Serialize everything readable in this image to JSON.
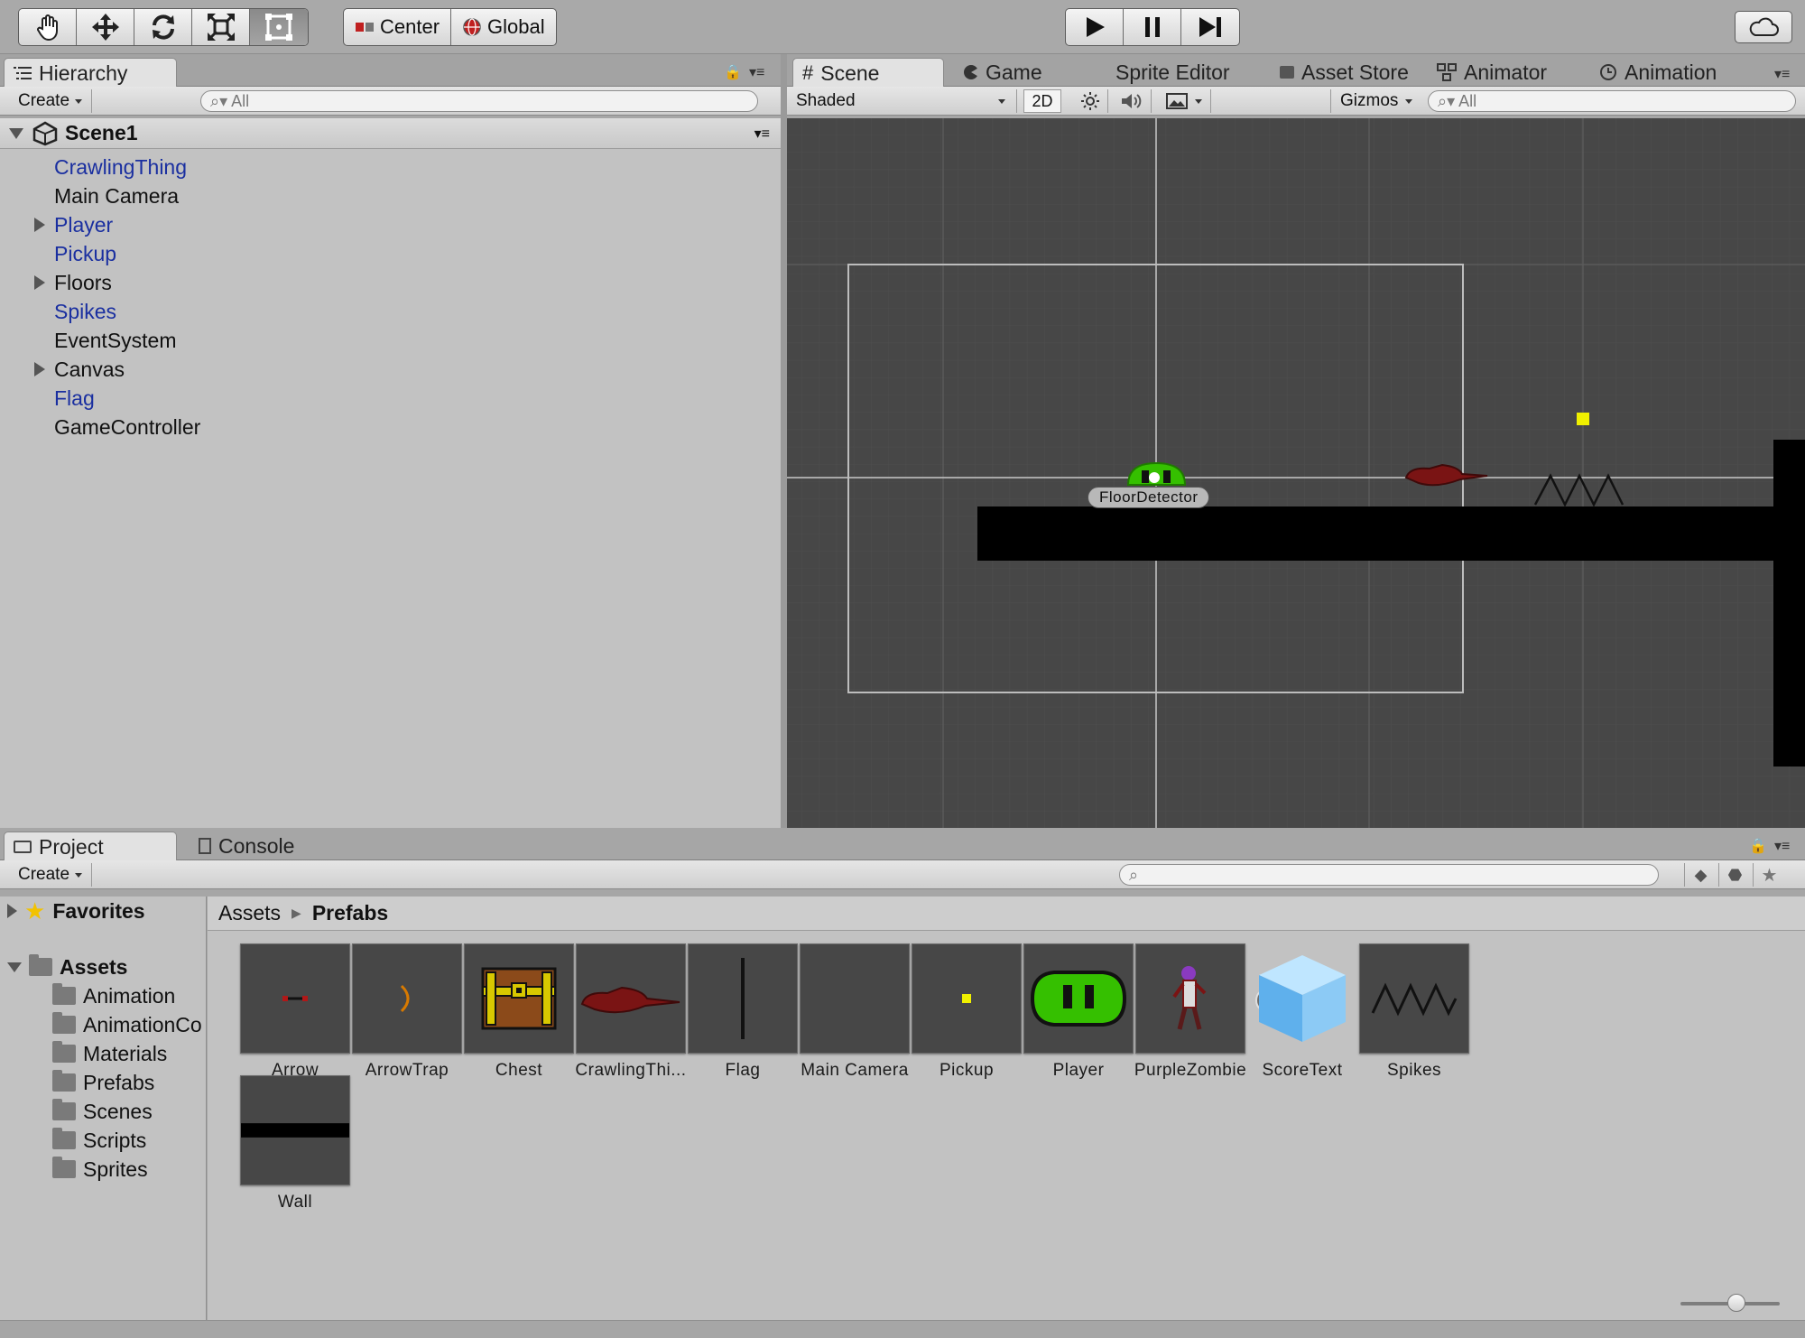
{
  "toolbar": {
    "tools": [
      "hand-tool",
      "move-tool",
      "rotate-tool",
      "scale-tool",
      "rect-tool"
    ],
    "pivot_label": "Center",
    "space_label": "Global",
    "play_icons": [
      "play-icon",
      "pause-icon",
      "step-icon"
    ],
    "cloud_icon": "cloud-icon"
  },
  "hierarchy": {
    "tab_label": "Hierarchy",
    "create_label": "Create",
    "search_placeholder": "All",
    "scene_name": "Scene1",
    "items": [
      {
        "label": "CrawlingThing",
        "prefab": true,
        "expandable": false
      },
      {
        "label": "Main Camera",
        "prefab": false,
        "expandable": false
      },
      {
        "label": "Player",
        "prefab": true,
        "expandable": true
      },
      {
        "label": "Pickup",
        "prefab": true,
        "expandable": false
      },
      {
        "label": "Floors",
        "prefab": false,
        "expandable": true
      },
      {
        "label": "Spikes",
        "prefab": true,
        "expandable": false
      },
      {
        "label": "EventSystem",
        "prefab": false,
        "expandable": false
      },
      {
        "label": "Canvas",
        "prefab": false,
        "expandable": true
      },
      {
        "label": "Flag",
        "prefab": true,
        "expandable": false
      },
      {
        "label": "GameController",
        "prefab": false,
        "expandable": false
      }
    ]
  },
  "scene_tabs": [
    {
      "label": "Scene",
      "icon": "grid-icon",
      "active": true
    },
    {
      "label": "Game",
      "icon": "pacman-icon",
      "active": false
    },
    {
      "label": "Sprite Editor",
      "icon": "",
      "active": false
    },
    {
      "label": "Asset Store",
      "icon": "bag-icon",
      "active": false
    },
    {
      "label": "Animator",
      "icon": "animator-icon",
      "active": false
    },
    {
      "label": "Animation",
      "icon": "clock-icon",
      "active": false
    }
  ],
  "scene_bar": {
    "shading_mode": "Shaded",
    "mode_2d": "2D",
    "gizmos_label": "Gizmos",
    "search_placeholder": "All"
  },
  "scene_view": {
    "selected_label": "FloorDetector",
    "colors": {
      "background": "#474747",
      "player": "#35c000",
      "enemy": "#7a1414",
      "pickup": "#f0f000",
      "floor": "#000000"
    }
  },
  "project": {
    "tab_label": "Project",
    "console_label": "Console",
    "create_label": "Create",
    "favorites_label": "Favorites",
    "assets_label": "Assets",
    "folders": [
      "Animation",
      "AnimationCo",
      "Materials",
      "Prefabs",
      "Scenes",
      "Scripts",
      "Sprites"
    ],
    "breadcrumb": [
      "Assets",
      "Prefabs"
    ],
    "prefabs": [
      {
        "label": "Arrow",
        "icon": "arrow-sprite",
        "has_children": false
      },
      {
        "label": "ArrowTrap",
        "icon": "arrowtrap-sprite",
        "has_children": true
      },
      {
        "label": "Chest",
        "icon": "chest-sprite",
        "has_children": true
      },
      {
        "label": "CrawlingThi...",
        "icon": "crawling-sprite",
        "has_children": false
      },
      {
        "label": "Flag",
        "icon": "flag-sprite",
        "has_children": false
      },
      {
        "label": "Main Camera",
        "icon": "camera-prefab",
        "has_children": false
      },
      {
        "label": "Pickup",
        "icon": "pickup-sprite",
        "has_children": false
      },
      {
        "label": "Player",
        "icon": "player-sprite",
        "has_children": true
      },
      {
        "label": "PurpleZombie",
        "icon": "zombie-sprite",
        "has_children": true
      },
      {
        "label": "ScoreText",
        "icon": "cube-icon",
        "has_children": false
      },
      {
        "label": "Spikes",
        "icon": "spikes-sprite",
        "has_children": false
      },
      {
        "label": "Wall",
        "icon": "wall-sprite",
        "has_children": false
      }
    ]
  }
}
